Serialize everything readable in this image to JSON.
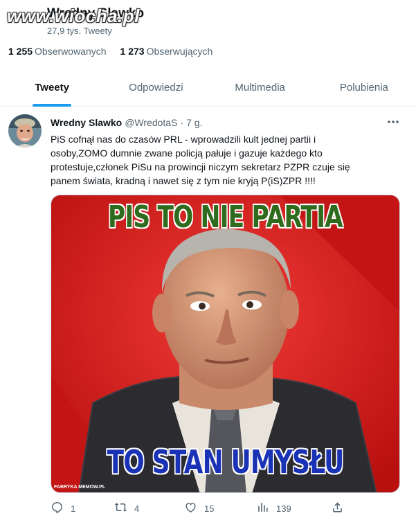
{
  "watermark": "www.wiocha.pl",
  "header": {
    "title": "Wredny Slawko",
    "tweet_count": "27,9 tys. Tweety"
  },
  "profile_stats": {
    "following_count": "1 255",
    "following_label": "Obserwowanych",
    "followers_count": "1 273",
    "followers_label": "Obserwujących"
  },
  "tabs": [
    {
      "label": "Tweety",
      "active": true
    },
    {
      "label": "Odpowiedzi",
      "active": false
    },
    {
      "label": "Multimedia",
      "active": false
    },
    {
      "label": "Polubienia",
      "active": false
    }
  ],
  "tweet": {
    "author": "Wredny Slawko",
    "handle": "@WredotaS",
    "separator": "·",
    "time": "7 g.",
    "text": "PiS cofnął nas do czasów PRL - wprowadzili kult jednej partii i osoby,ZOMO dumnie zwane policją pałuje i gazuje każdego kto protestuje,członek PiSu na prowincji niczym sekretarz PZPR czuje się panem świata, kradną i nawet się z tym nie kryją   P(iS)ZPR  !!!!",
    "media": {
      "top_text": "PIS TO NIE PARTIA",
      "bottom_text": "TO STAN UMYSŁU",
      "credit": "FABRYKA MEMOW.PL"
    },
    "actions": {
      "replies": "1",
      "retweets": "4",
      "likes": "15",
      "views": "139"
    }
  },
  "colors": {
    "accent": "#1d9bf0",
    "secondary_text": "#536471",
    "meme_red": "#d9191c",
    "meme_green": "#2e6b1c",
    "meme_blue": "#1a32b5"
  }
}
